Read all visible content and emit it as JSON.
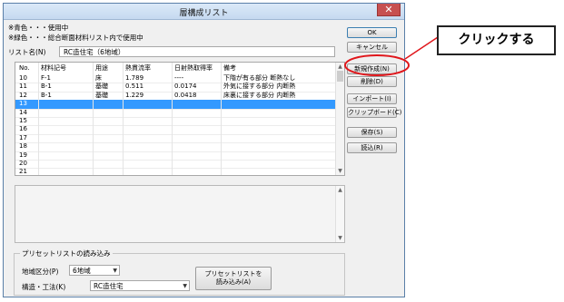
{
  "window": {
    "title": "層構成リスト",
    "close_glyph": "✕"
  },
  "notes": [
    "※青色・・・使用中",
    "※緑色・・・総合断面材料リスト内で使用中"
  ],
  "list_name": {
    "label": "リスト名(N)",
    "value": "RC造住宅（6地域）"
  },
  "table": {
    "columns": [
      "No.",
      "材料記号",
      "用途",
      "熱貫流率",
      "日射熱取得率",
      "備考"
    ],
    "rows": [
      [
        "10",
        "F-1",
        "床",
        "1.789",
        "----",
        "下階が有る部分 断熱なし"
      ],
      [
        "11",
        "B-1",
        "基礎",
        "0.511",
        "0.0174",
        "外気に接する部分 内断熱"
      ],
      [
        "12",
        "B-1",
        "基礎",
        "1.229",
        "0.0418",
        "床裏に接する部分 内断熱"
      ],
      [
        "13",
        "",
        "",
        "",
        "",
        ""
      ],
      [
        "14",
        "",
        "",
        "",
        "",
        ""
      ],
      [
        "15",
        "",
        "",
        "",
        "",
        ""
      ],
      [
        "16",
        "",
        "",
        "",
        "",
        ""
      ],
      [
        "17",
        "",
        "",
        "",
        "",
        ""
      ],
      [
        "18",
        "",
        "",
        "",
        "",
        ""
      ],
      [
        "19",
        "",
        "",
        "",
        "",
        ""
      ],
      [
        "20",
        "",
        "",
        "",
        "",
        ""
      ],
      [
        "21",
        "",
        "",
        "",
        "",
        ""
      ]
    ],
    "selected_row": "13"
  },
  "preset": {
    "group_title": "プリセットリストの読み込み",
    "region_label": "地域区分(P)",
    "region_value": "6地域",
    "structure_label": "構造・工法(K)",
    "structure_value": "RC造住宅",
    "load_button_line1": "プリセットリストを",
    "load_button_line2": "読み込み(A)"
  },
  "buttons": {
    "ok": "OK",
    "cancel": "キャンセル",
    "new": "新規作成(N)",
    "delete": "削除(D)",
    "import": "インポート(I)",
    "clipboard": "クリップボード(C)",
    "save": "保存(S)",
    "load": "読込(R)"
  },
  "callout": {
    "text": "クリックする"
  },
  "colors": {
    "selected_row": "#3399ff",
    "highlight_circle": "#e0161b",
    "title_bar": "#c5d9f0"
  }
}
